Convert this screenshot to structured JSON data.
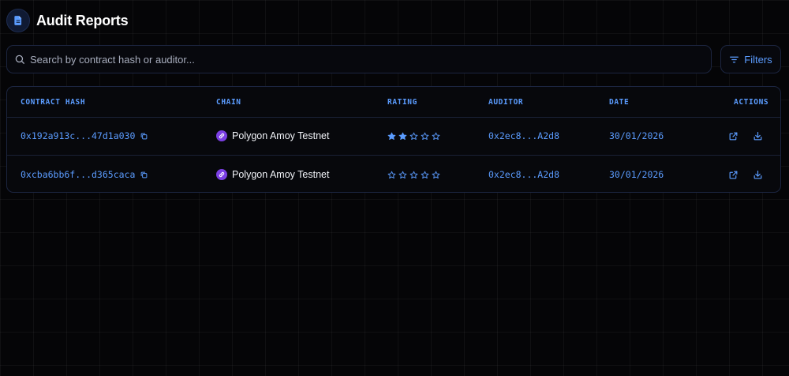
{
  "header": {
    "title": "Audit Reports",
    "icon": "document-icon"
  },
  "search": {
    "placeholder": "Search by contract hash or auditor...",
    "value": ""
  },
  "filters": {
    "label": "Filters",
    "icon": "filter-lines-icon"
  },
  "table": {
    "columns": [
      "CONTRACT HASH",
      "CHAIN",
      "RATING",
      "AUDITOR",
      "DATE",
      "ACTIONS"
    ],
    "rows": [
      {
        "contract_hash": "0x192a913c...47d1a030",
        "chain": "Polygon Amoy Testnet",
        "rating": 2,
        "rating_max": 5,
        "auditor": "0x2ec8...A2d8",
        "date": "30/01/2026"
      },
      {
        "contract_hash": "0xcba6bb6f...d365caca",
        "chain": "Polygon Amoy Testnet",
        "rating": 0,
        "rating_max": 5,
        "auditor": "0x2ec8...A2d8",
        "date": "30/01/2026"
      }
    ]
  },
  "colors": {
    "accent": "#5b9cff",
    "background": "#050507",
    "border": "#1c2540",
    "chain_badge": "#7b3fe4",
    "text": "#f1f3f8"
  }
}
